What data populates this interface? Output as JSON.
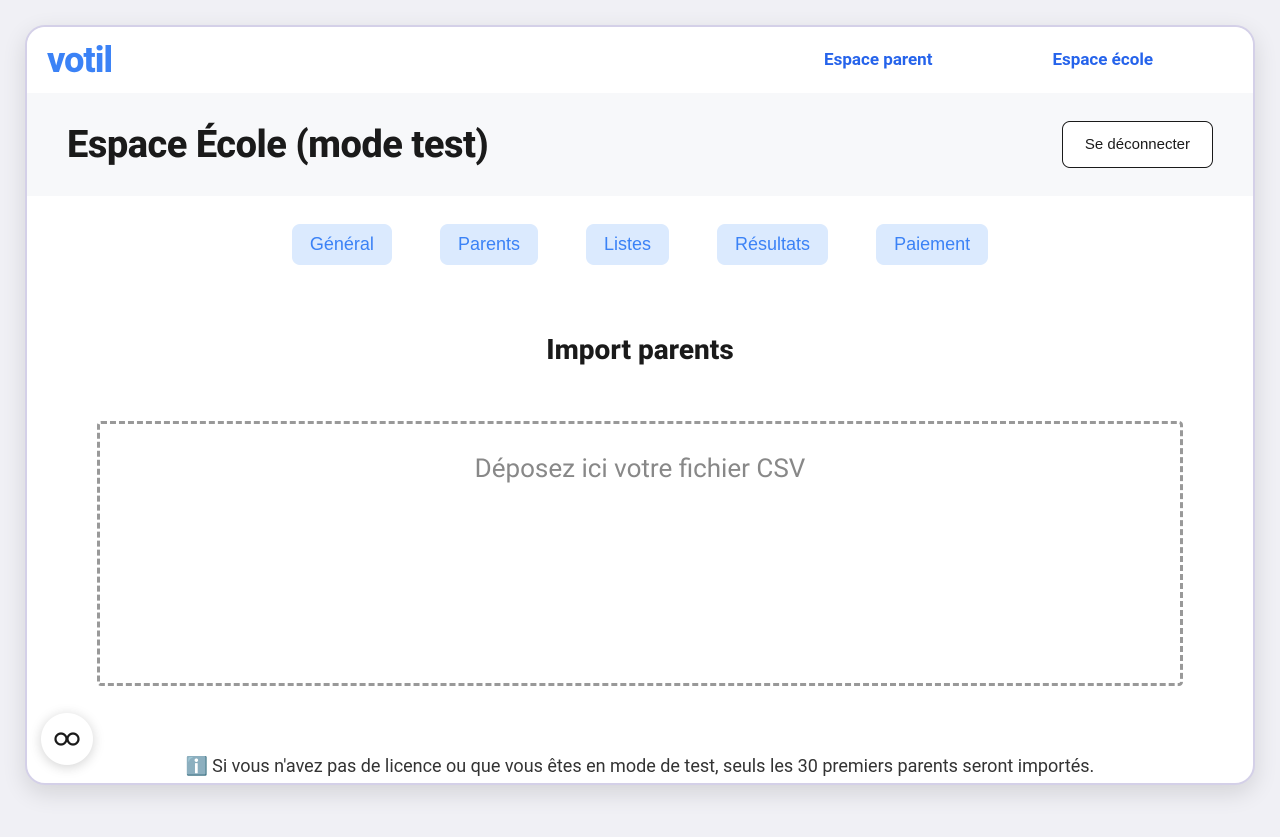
{
  "logo": "votil",
  "nav": {
    "parent_link": "Espace parent",
    "school_link": "Espace école"
  },
  "header": {
    "title": "Espace École (mode test)",
    "logout_label": "Se déconnecter"
  },
  "tabs": {
    "general": "Général",
    "parents": "Parents",
    "lists": "Listes",
    "results": "Résultats",
    "payment": "Paiement"
  },
  "content": {
    "section_title": "Import parents",
    "dropzone_text": "Déposez ici votre fichier CSV"
  },
  "info": {
    "icon": "ℹ️",
    "text": "Si vous n'avez pas de licence ou que vous êtes en mode de test, seuls les 30 premiers parents seront importés."
  }
}
